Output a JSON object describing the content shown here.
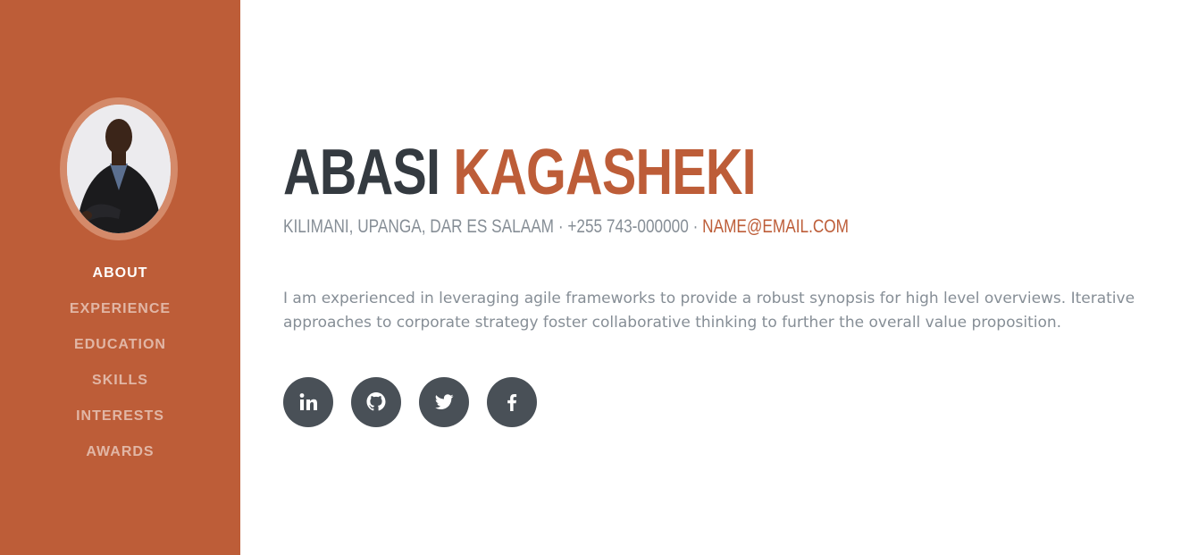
{
  "sidebar": {
    "avatar_alt": "Abasi Kagasheki profile photo",
    "nav": [
      {
        "label": "ABOUT",
        "active": true
      },
      {
        "label": "EXPERIENCE"
      },
      {
        "label": "EDUCATION"
      },
      {
        "label": "SKILLS"
      },
      {
        "label": "INTERESTS"
      },
      {
        "label": "AWARDS"
      }
    ]
  },
  "header": {
    "first_name": "ABASI",
    "last_name": "KAGASHEKI",
    "address": "KILIMANI, UPANGA, DAR ES SALAAM",
    "separator": " · ",
    "phone": "+255 743-000000",
    "email": "NAME@EMAIL.COM"
  },
  "bio": "I am experienced in leveraging agile frameworks to provide a robust synopsis for high level overviews. Iterative approaches to corporate strategy foster collaborative thinking to further the overall value proposition.",
  "social": [
    {
      "icon": "linkedin-icon"
    },
    {
      "icon": "github-icon"
    },
    {
      "icon": "twitter-icon"
    },
    {
      "icon": "facebook-icon"
    }
  ],
  "colors": {
    "primary": "#bd5d38",
    "dark": "#343a40",
    "muted": "#868e96",
    "social_bg": "#495057"
  }
}
